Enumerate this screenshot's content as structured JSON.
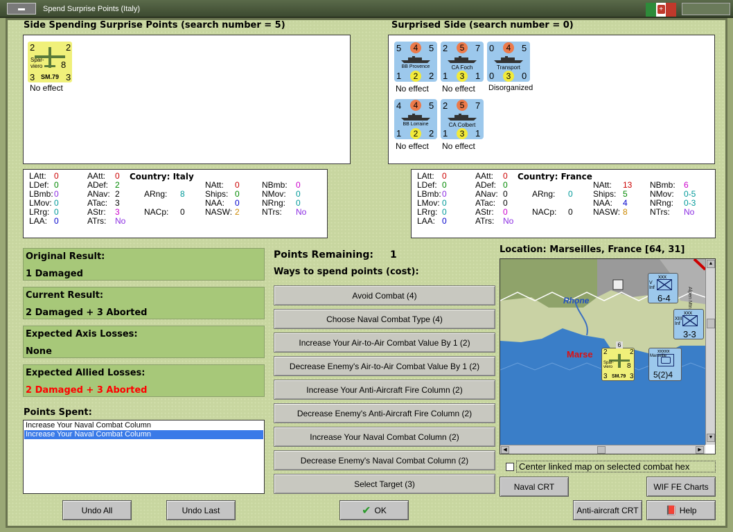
{
  "window": {
    "title": "Spend Surprise Points (Italy)",
    "flag_colors": [
      "#2e8b3a",
      "#ffffff",
      "#c0392b"
    ]
  },
  "spending": {
    "title": "Side Spending Surprise Points (search number = 5)",
    "units": [
      {
        "top_left": "2",
        "top_right": "2",
        "bottom_left": "3",
        "bottom_right": "3",
        "middle_right": "8",
        "label": "Spar- viero",
        "type": "SM.79",
        "caption": "No effect"
      }
    ]
  },
  "surprised": {
    "title": "Surprised Side (search number = 0)",
    "units": [
      {
        "tl": "5",
        "tc": "4",
        "tr": "5",
        "name": "BB Provence",
        "bl": "1",
        "bc": "2",
        "br": "2",
        "caption": "No effect",
        "tc_color": "#ec7a4a",
        "bc_color": "#f2ea3a"
      },
      {
        "tl": "2",
        "tc": "5",
        "tr": "7",
        "name": "CA Foch",
        "bl": "1",
        "bc": "3",
        "br": "1",
        "caption": "No effect",
        "tc_color": "#ec7a4a",
        "bc_color": "#f2ea3a"
      },
      {
        "tl": "0",
        "tc": "4",
        "tr": "5",
        "name": "Transport",
        "bl": "0",
        "bc": "3",
        "br": "0",
        "caption": "Disorganized",
        "tc_color": "#ec7a4a",
        "bc_color": "#f2ea3a"
      },
      {
        "tl": "4",
        "tc": "4",
        "tr": "5",
        "name": "BB Lorraine",
        "bl": "1",
        "bc": "2",
        "br": "2",
        "caption": "No effect",
        "tc_color": "#ec7a4a",
        "bc_color": "#f2ea3a"
      },
      {
        "tl": "2",
        "tc": "5",
        "tr": "7",
        "name": "CA Colbert",
        "bl": "1",
        "bc": "3",
        "br": "1",
        "caption": "No effect",
        "tc_color": "#ec7a4a",
        "bc_color": "#f2ea3a"
      }
    ]
  },
  "italy_stats": {
    "country_label": "Country: Italy",
    "rows": [
      {
        "k": "LAtt:",
        "v": "0",
        "c": "#cc0000"
      },
      {
        "k": "LDef:",
        "v": "0",
        "c": "#008800"
      },
      {
        "k": "LBmb:",
        "v": "0",
        "c": "#8a2be2"
      },
      {
        "k": "LMov:",
        "v": "0",
        "c": "#009999"
      },
      {
        "k": "LRrg:",
        "v": "0",
        "c": "#009999"
      },
      {
        "k": "LAA:",
        "v": "0",
        "c": "#0000cc"
      },
      {
        "k": "AAtt:",
        "v": "0",
        "c": "#cc0000"
      },
      {
        "k": "ADef:",
        "v": "2",
        "c": "#008800"
      },
      {
        "k": "ANav:",
        "v": "2",
        "c": "#000000"
      },
      {
        "k": "ATac:",
        "v": "3",
        "c": "#000000"
      },
      {
        "k": "AStr:",
        "v": "3",
        "c": "#cc00cc"
      },
      {
        "k": "ATrs:",
        "v": "No",
        "c": "#8a2be2"
      },
      {
        "k": "ARng:",
        "v": "8",
        "c": "#009999"
      },
      {
        "k": "NACp:",
        "v": "0",
        "c": "#000000"
      },
      {
        "k": "NAtt:",
        "v": "0",
        "c": "#cc0000"
      },
      {
        "k": "Ships:",
        "v": "0",
        "c": "#008800"
      },
      {
        "k": "NAA:",
        "v": "0",
        "c": "#0000cc"
      },
      {
        "k": "NASW:",
        "v": "2",
        "c": "#cc8800"
      },
      {
        "k": "NBmb:",
        "v": "0",
        "c": "#cc00cc"
      },
      {
        "k": "NMov:",
        "v": "0",
        "c": "#009999"
      },
      {
        "k": "NRng:",
        "v": "0",
        "c": "#009999"
      },
      {
        "k": "NTrs:",
        "v": "No",
        "c": "#8a2be2"
      }
    ]
  },
  "france_stats": {
    "country_label": "Country: France",
    "rows": [
      {
        "k": "LAtt:",
        "v": "0",
        "c": "#cc0000"
      },
      {
        "k": "LDef:",
        "v": "0",
        "c": "#008800"
      },
      {
        "k": "LBmb:",
        "v": "0",
        "c": "#8a2be2"
      },
      {
        "k": "LMov:",
        "v": "0",
        "c": "#009999"
      },
      {
        "k": "LRrg:",
        "v": "0",
        "c": "#009999"
      },
      {
        "k": "LAA:",
        "v": "0",
        "c": "#0000cc"
      },
      {
        "k": "AAtt:",
        "v": "0",
        "c": "#cc0000"
      },
      {
        "k": "ADef:",
        "v": "0",
        "c": "#008800"
      },
      {
        "k": "ANav:",
        "v": "0",
        "c": "#000000"
      },
      {
        "k": "ATac:",
        "v": "0",
        "c": "#000000"
      },
      {
        "k": "AStr:",
        "v": "0",
        "c": "#cc00cc"
      },
      {
        "k": "ATrs:",
        "v": "No",
        "c": "#8a2be2"
      },
      {
        "k": "ARng:",
        "v": "0",
        "c": "#009999"
      },
      {
        "k": "NACp:",
        "v": "0",
        "c": "#000000"
      },
      {
        "k": "NAtt:",
        "v": "13",
        "c": "#cc0000"
      },
      {
        "k": "Ships:",
        "v": "5",
        "c": "#008800"
      },
      {
        "k": "NAA:",
        "v": "4",
        "c": "#0000cc"
      },
      {
        "k": "NASW:",
        "v": "8",
        "c": "#cc8800"
      },
      {
        "k": "NBmb:",
        "v": "6",
        "c": "#cc00cc"
      },
      {
        "k": "NMov:",
        "v": "0-5",
        "c": "#009999"
      },
      {
        "k": "NRng:",
        "v": "0-3",
        "c": "#009999"
      },
      {
        "k": "NTrs:",
        "v": "No",
        "c": "#8a2be2"
      }
    ]
  },
  "results": {
    "original_label": "Original Result:",
    "original_value": "1 Damaged",
    "current_label": "Current Result:",
    "current_value": "2 Damaged + 3 Aborted",
    "axis_label": "Expected Axis Losses:",
    "axis_value": "None",
    "allied_label": "Expected Allied Losses:",
    "allied_value": "2 Damaged + 3 Aborted",
    "allied_color": "#ff0000"
  },
  "points_spent": {
    "label": "Points Spent:",
    "items": [
      "Increase Your Naval Combat Column",
      "Increase Your Naval Combat Column"
    ],
    "selected_index": 1
  },
  "points": {
    "remaining_label": "Points Remaining:",
    "remaining_value": "1",
    "ways_label": "Ways to spend points (cost):"
  },
  "ways": [
    "Avoid Combat (4)",
    "Choose Naval Combat Type (4)",
    "Increase Your Air-to-Air Combat Value By 1 (2)",
    "Decrease Enemy's Air-to-Air Combat Value By 1 (2)",
    "Increase Your Anti-Aircraft Fire Column (2)",
    "Decrease Enemy's Anti-Aircraft Fire Column (2)",
    "Increase Your Naval Combat Column (2)",
    "Decrease Enemy's Naval Combat Column (2)",
    "Select Target (3)"
  ],
  "map": {
    "location": "Location: Marseilles, France [64, 31]",
    "river_label": "Rhone",
    "city_label": "Marse",
    "unit1": {
      "code": "xxx",
      "label": "V Inf",
      "value": "6-4"
    },
    "unit2": {
      "code": "xxx",
      "label": "XIII Inf",
      "value": "3-3"
    },
    "unit3": {
      "code": "xxxxx",
      "label": "Marseille",
      "value": "5(2)4"
    },
    "stack_num": "6",
    "air": {
      "tl": "2",
      "tr": "2",
      "bl": "3",
      "br": "3",
      "mr": "8",
      "type": "SM.79",
      "label": "Spar- viero"
    },
    "side_text": "Alpen Mtn",
    "center_checkbox_label": "Center linked map on selected combat hex"
  },
  "buttons": {
    "undo_all": "Undo All",
    "undo_last": "Undo Last",
    "ok": "OK",
    "naval_crt": "Naval CRT",
    "wif_fe_charts": "WIF FE Charts",
    "aa_crt": "Anti-aircraft CRT",
    "help": "Help"
  }
}
